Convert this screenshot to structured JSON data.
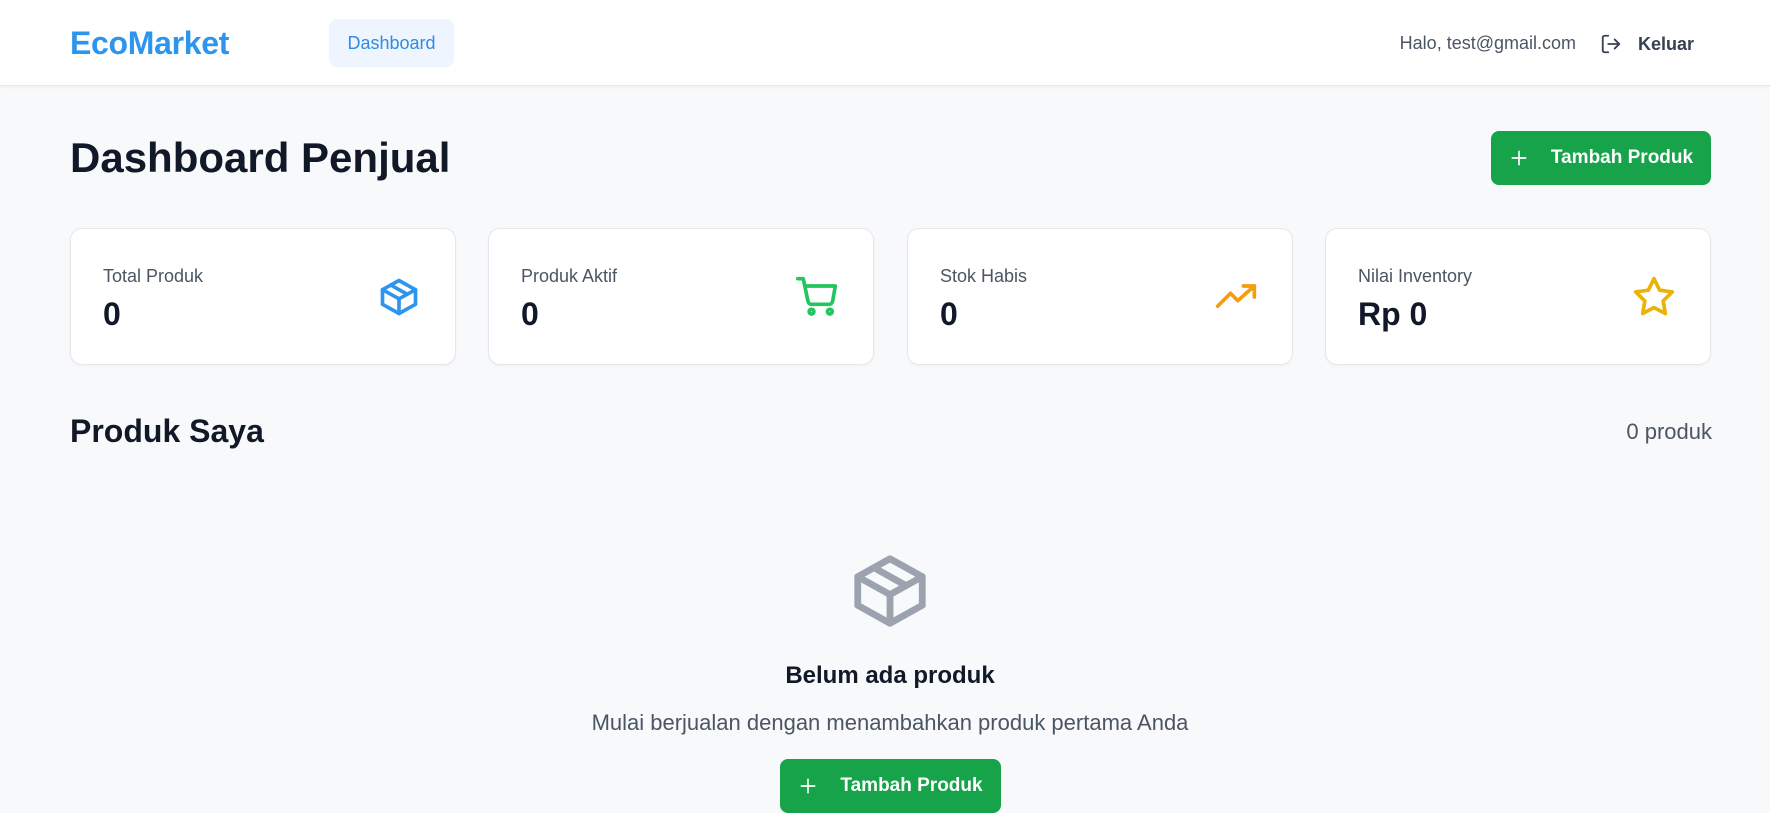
{
  "header": {
    "logo": "EcoMarket",
    "nav": {
      "dashboard": "Dashboard"
    },
    "greeting": "Halo, test@gmail.com",
    "logout_label": "Keluar"
  },
  "page": {
    "title": "Dashboard Penjual",
    "add_button": "Tambah Produk"
  },
  "stats": [
    {
      "label": "Total Produk",
      "value": "0",
      "icon": "box-icon",
      "color": "#2e95ee"
    },
    {
      "label": "Produk Aktif",
      "value": "0",
      "icon": "cart-icon",
      "color": "#22c55e"
    },
    {
      "label": "Stok Habis",
      "value": "0",
      "icon": "trending-up-icon",
      "color": "#f59e0b"
    },
    {
      "label": "Nilai Inventory",
      "value": "Rp 0",
      "icon": "star-icon",
      "color": "#eab308"
    }
  ],
  "products": {
    "title": "Produk Saya",
    "count": "0 produk",
    "empty": {
      "title": "Belum ada produk",
      "subtitle": "Mulai berjualan dengan menambahkan produk pertama Anda",
      "button": "Tambah Produk"
    }
  },
  "colors": {
    "brand": "#2e95ee",
    "primary_action": "#16a34a",
    "background": "#f8f9fb"
  }
}
